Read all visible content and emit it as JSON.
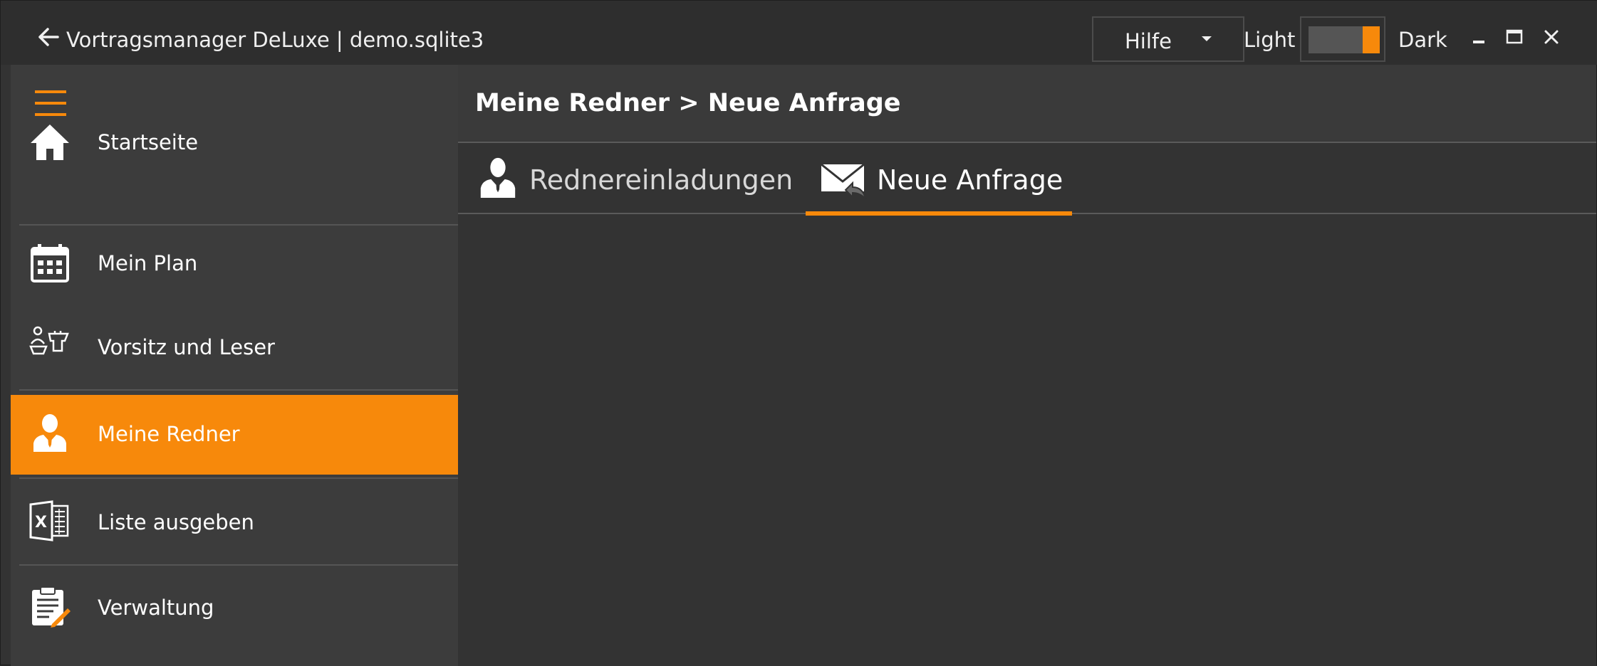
{
  "window": {
    "title": "Vortragsmanager DeLuxe | demo.sqlite3"
  },
  "titlebar": {
    "help_dropdown": {
      "label": "Hilfe"
    },
    "theme": {
      "light_label": "Light",
      "dark_label": "Dark",
      "selected": "Dark"
    }
  },
  "colors": {
    "accent": "#f7890b",
    "sidebar_bg": "#3c3c3c",
    "content_bg": "#333333"
  },
  "sidebar": {
    "items": [
      {
        "label": "Startseite",
        "icon": "home-icon",
        "active": false
      },
      {
        "label": "Mein Plan",
        "icon": "calendar-icon",
        "active": false
      },
      {
        "label": "Vorsitz und Leser",
        "icon": "lectern-icon",
        "active": false
      },
      {
        "label": "Meine Redner",
        "icon": "speaker-person-icon",
        "active": true
      },
      {
        "label": "Liste ausgeben",
        "icon": "excel-icon",
        "active": false
      },
      {
        "label": "Verwaltung",
        "icon": "clipboard-edit-icon",
        "active": false
      }
    ]
  },
  "main": {
    "page_title": "Meine Redner > Neue Anfrage",
    "tabs": [
      {
        "label": "Rednereinladungen",
        "icon": "speaker-person-icon",
        "selected": false
      },
      {
        "label": "Neue Anfrage",
        "icon": "envelope-reply-icon",
        "selected": true
      }
    ]
  }
}
